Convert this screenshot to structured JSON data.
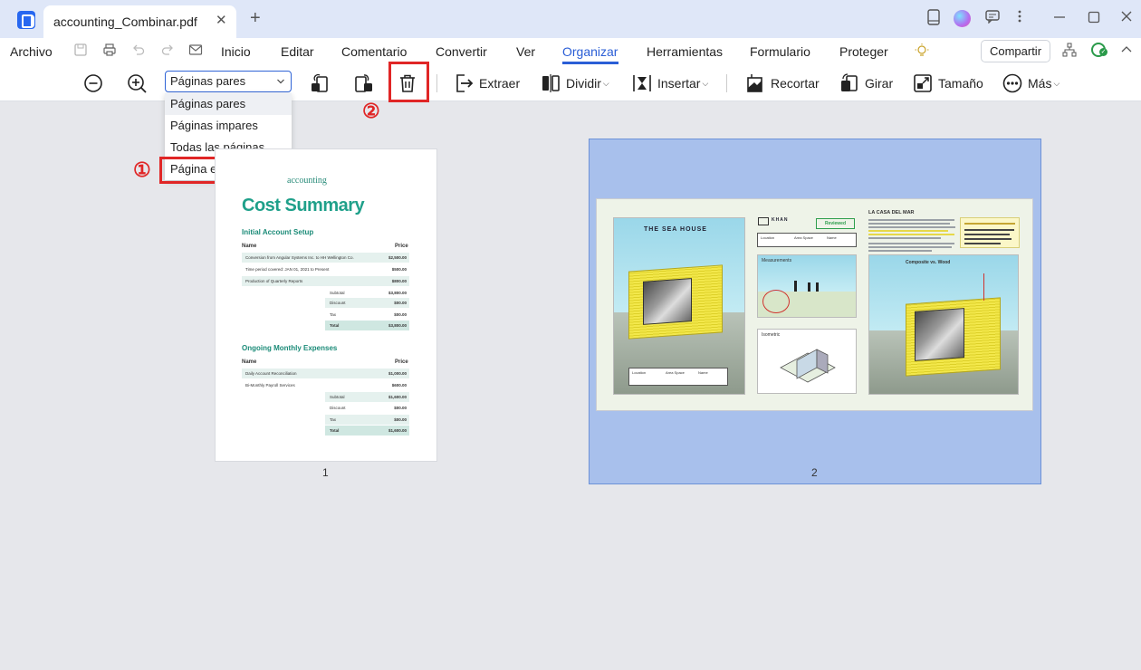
{
  "tab": {
    "title": "accounting_Combinar.pdf",
    "close": "✕",
    "add": "+"
  },
  "menubar": {
    "file": "Archivo",
    "items": [
      "Inicio",
      "Editar",
      "Comentario",
      "Convertir",
      "Ver",
      "Organizar",
      "Herramientas",
      "Formulario",
      "Proteger"
    ],
    "active": "Organizar",
    "share": "Compartir"
  },
  "toolbar": {
    "page_select": {
      "value": "Páginas pares",
      "options": [
        "Páginas pares",
        "Páginas impares",
        "Todas las páginas",
        "Página en Blanco"
      ]
    },
    "extract": "Extraer",
    "split": "Dividir",
    "insert": "Insertar",
    "crop": "Recortar",
    "rotate": "Girar",
    "size": "Tamaño",
    "more": "Más"
  },
  "annotations": {
    "step1": "①",
    "step2": "②"
  },
  "pages": [
    {
      "number": "1",
      "logo": "accounting",
      "title": "Cost Summary",
      "section1": {
        "heading": "Initial Account Setup",
        "col_name": "Name",
        "col_price": "Price",
        "rows": [
          {
            "desc": "Conversion from Angular Systems Inc. to HH Wellington Co.",
            "amount": "$2,500.00"
          },
          {
            "desc": "Time period covered: JAN 01, 2021 to Present",
            "amount": "$500.00"
          },
          {
            "desc": "Production of Quarterly Reports",
            "amount": "$800.00"
          }
        ],
        "summary": [
          {
            "label": "Subtotal",
            "amount": "$3,800.00"
          },
          {
            "label": "Discount",
            "amount": "$00.00"
          },
          {
            "label": "Tax",
            "amount": "$00.00"
          },
          {
            "label": "Total",
            "amount": "$3,800.00"
          }
        ]
      },
      "section2": {
        "heading": "Ongoing Monthly Expenses",
        "col_name": "Name",
        "col_price": "Price",
        "rows": [
          {
            "desc": "Daily Account Reconciliation",
            "amount": "$1,000.00"
          },
          {
            "desc": "Bi-Monthly Payroll Services",
            "amount": "$600.00"
          }
        ],
        "summary": [
          {
            "label": "Subtotal",
            "amount": "$1,600.00"
          },
          {
            "label": "Discount",
            "amount": "$00.00"
          },
          {
            "label": "Tax",
            "amount": "$00.00"
          },
          {
            "label": "Total",
            "amount": "$1,600.00"
          }
        ]
      }
    },
    {
      "number": "2",
      "sea_house": "THE SEA HOUSE",
      "firm": "KHAN",
      "reviewed": "Reviewed",
      "la_casa": "LA CASA DEL MAR",
      "measurements": "Measurements",
      "isometric": "Isometric",
      "composite": "Composite vs. Wood",
      "info_labels": [
        "Location",
        "Area Space",
        "Name"
      ]
    }
  ],
  "colors": {
    "accent": "#2a5ed6",
    "annotation": "#e02626",
    "teal": "#1fa08a",
    "selection": "#a8c0ec"
  }
}
